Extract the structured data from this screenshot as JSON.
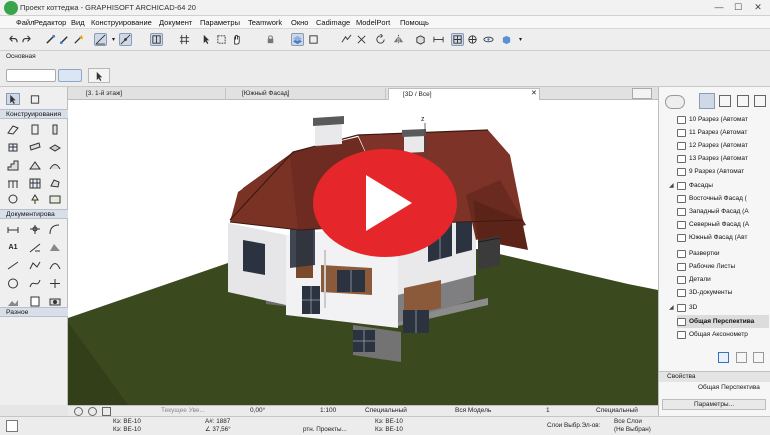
{
  "window": {
    "title": "Проект коттеджа - GRAPHISOFT ARCHICAD-64 20",
    "minimize_glyph": "—",
    "maximize_glyph": "☐",
    "close_glyph": "✕"
  },
  "menu": [
    "Файл",
    "Редактор",
    "Вид",
    "Конструирование",
    "Документ",
    "Параметры",
    "Teamwork",
    "Окно",
    "Cadimage",
    "ModelPort",
    "Помощь"
  ],
  "infobox": {
    "label": "Основная"
  },
  "toolbox": {
    "section_construct": "Конструирования",
    "section_document": "Документирова",
    "section_misc": "Разное"
  },
  "tabs": [
    {
      "label": "[3. 1-й этаж]"
    },
    {
      "label": "[Южный Фасад]"
    },
    {
      "label": "[3D / Все]"
    }
  ],
  "viewport": {
    "axis_z": "z",
    "play_icon": "play-icon"
  },
  "statusbar": {
    "current_view": "Текущее Уве...",
    "angle": "0,00°",
    "scale": "1:100",
    "layer1": "Специальный",
    "model": "Вся Модель",
    "num": "1",
    "layer2": "Специальный"
  },
  "footer": {
    "k1": "Кэ: BE-10",
    "k2": "Кэ: BE-10",
    "a1": "A#: 1887",
    "a2": "∠ 37,56°",
    "rtn": "ртн. Проекты...",
    "k3": "Кэ: BE-10",
    "k4": "Кэ: BE-10",
    "layers": "Слои Выбр.Эл-ов:",
    "all_layers": "Все Слои",
    "not_sel": "(Не Выбран)"
  },
  "navigator": {
    "items": [
      {
        "label": "10 Разрез (Автомат",
        "level": 1
      },
      {
        "label": "11 Разрез (Автомат",
        "level": 1
      },
      {
        "label": "12 Разрез (Автомат",
        "level": 1
      },
      {
        "label": "13 Разрез (Автомат",
        "level": 1
      },
      {
        "label": "9 Разрез (Автомат",
        "level": 1
      },
      {
        "label": "Фасады",
        "level": 0
      },
      {
        "label": "Восточный Фасад (",
        "level": 1
      },
      {
        "label": "Западный Фасад (А",
        "level": 1
      },
      {
        "label": "Северный Фасад (А",
        "level": 1
      },
      {
        "label": "Южный Фасад (Авт",
        "level": 1
      },
      {
        "label": "Развертки",
        "level": 0
      },
      {
        "label": "Рабочие Листы",
        "level": 0
      },
      {
        "label": "Детали",
        "level": 0
      },
      {
        "label": "3D-документы",
        "level": 0
      },
      {
        "label": "3D",
        "level": 0
      },
      {
        "label": "Общая Перспектива",
        "level": 1
      },
      {
        "label": "Общая Аксонометр",
        "level": 1
      }
    ],
    "props_title": "Свойства",
    "props_value": "Общая Перспектива",
    "params_button": "Параметры..."
  },
  "colors": {
    "play_red": "#e5262a",
    "grass": "#3b4a1e",
    "roof": "#7a3225"
  }
}
